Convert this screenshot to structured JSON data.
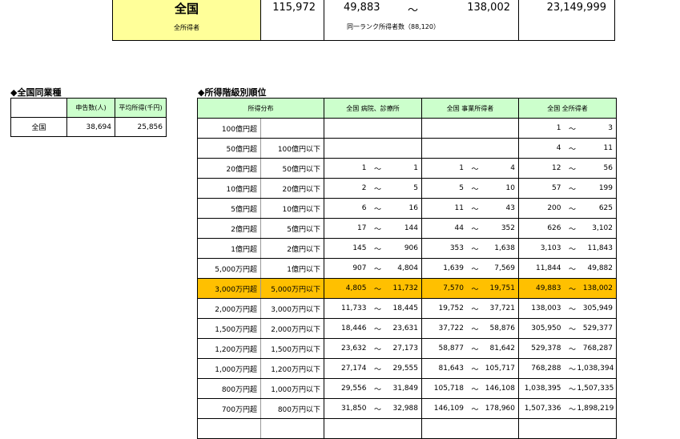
{
  "top": {
    "region": "全国",
    "region_sub": "全所得者",
    "count": "115,972",
    "range_low": "49,883",
    "tilde": "～",
    "range_high": "138,002",
    "note": "同一ランク所得者数（88,120）",
    "max": "23,149,999"
  },
  "left_section": {
    "title": "◆全国同業種",
    "headers": [
      "",
      "申告数(人)",
      "平均所得(千円)"
    ],
    "rows": [
      {
        "label": "全国",
        "count": "38,694",
        "avg": "25,856"
      }
    ]
  },
  "rank_section": {
    "title": "◆所得階級別順位",
    "headers": [
      "所得分布",
      "全国 病院、診療所",
      "全国 事業所得者",
      "全国 全所得者"
    ],
    "tilde": "～",
    "rows": [
      {
        "lo": "100億円超",
        "hi": "",
        "c1": [
          "",
          ""
        ],
        "c2": [
          "",
          ""
        ],
        "c3": [
          "1",
          "3"
        ]
      },
      {
        "lo": "50億円超",
        "hi": "100億円以下",
        "c1": [
          "",
          ""
        ],
        "c2": [
          "",
          ""
        ],
        "c3": [
          "4",
          "11"
        ]
      },
      {
        "lo": "20億円超",
        "hi": "50億円以下",
        "c1": [
          "1",
          "1"
        ],
        "c2": [
          "1",
          "4"
        ],
        "c3": [
          "12",
          "56"
        ]
      },
      {
        "lo": "10億円超",
        "hi": "20億円以下",
        "c1": [
          "2",
          "5"
        ],
        "c2": [
          "5",
          "10"
        ],
        "c3": [
          "57",
          "199"
        ]
      },
      {
        "lo": "5億円超",
        "hi": "10億円以下",
        "c1": [
          "6",
          "16"
        ],
        "c2": [
          "11",
          "43"
        ],
        "c3": [
          "200",
          "625"
        ]
      },
      {
        "lo": "2億円超",
        "hi": "5億円以下",
        "c1": [
          "17",
          "144"
        ],
        "c2": [
          "44",
          "352"
        ],
        "c3": [
          "626",
          "3,102"
        ]
      },
      {
        "lo": "1億円超",
        "hi": "2億円以下",
        "c1": [
          "145",
          "906"
        ],
        "c2": [
          "353",
          "1,638"
        ],
        "c3": [
          "3,103",
          "11,843"
        ]
      },
      {
        "lo": "5,000万円超",
        "hi": "1億円以下",
        "c1": [
          "907",
          "4,804"
        ],
        "c2": [
          "1,639",
          "7,569"
        ],
        "c3": [
          "11,844",
          "49,882"
        ]
      },
      {
        "lo": "3,000万円超",
        "hi": "5,000万円以下",
        "c1": [
          "4,805",
          "11,732"
        ],
        "c2": [
          "7,570",
          "19,751"
        ],
        "c3": [
          "49,883",
          "138,002"
        ],
        "highlight": true
      },
      {
        "lo": "2,000万円超",
        "hi": "3,000万円以下",
        "c1": [
          "11,733",
          "18,445"
        ],
        "c2": [
          "19,752",
          "37,721"
        ],
        "c3": [
          "138,003",
          "305,949"
        ]
      },
      {
        "lo": "1,500万円超",
        "hi": "2,000万円以下",
        "c1": [
          "18,446",
          "23,631"
        ],
        "c2": [
          "37,722",
          "58,876"
        ],
        "c3": [
          "305,950",
          "529,377"
        ]
      },
      {
        "lo": "1,200万円超",
        "hi": "1,500万円以下",
        "c1": [
          "23,632",
          "27,173"
        ],
        "c2": [
          "58,877",
          "81,642"
        ],
        "c3": [
          "529,378",
          "768,287"
        ]
      },
      {
        "lo": "1,000万円超",
        "hi": "1,200万円以下",
        "c1": [
          "27,174",
          "29,555"
        ],
        "c2": [
          "81,643",
          "105,717"
        ],
        "c3": [
          "768,288",
          "1,038,394"
        ]
      },
      {
        "lo": "800万円超",
        "hi": "1,000万円以下",
        "c1": [
          "29,556",
          "31,849"
        ],
        "c2": [
          "105,718",
          "146,108"
        ],
        "c3": [
          "1,038,395",
          "1,507,335"
        ]
      },
      {
        "lo": "700万円超",
        "hi": "800万円以下",
        "c1": [
          "31,850",
          "32,988"
        ],
        "c2": [
          "146,109",
          "178,960"
        ],
        "c3": [
          "1,507,336",
          "1,898,219"
        ]
      },
      {
        "lo": "",
        "hi": "",
        "c1": [
          "",
          ""
        ],
        "c2": [
          "",
          ""
        ],
        "c3": [
          "",
          ""
        ]
      }
    ]
  }
}
